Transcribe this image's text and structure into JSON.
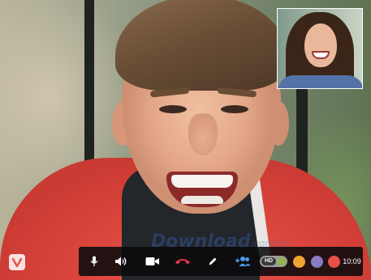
{
  "toolbar": {
    "icons": {
      "mic": "microphone-icon",
      "speaker": "speaker-icon",
      "video": "video-camera-icon",
      "hangup": "phone-hangup-icon",
      "draw": "pen-icon",
      "add_user": "add-user-icon"
    },
    "hd_label": "HD",
    "hd_enabled": true,
    "color_swatches": [
      "#f0a532",
      "#8a7bc4",
      "#e8504a"
    ],
    "time": "10:09"
  },
  "watermark": {
    "text": "Download",
    "suffix": ".com.vn"
  },
  "app_logo": {
    "letter": "V"
  },
  "colors": {
    "toolbar_bg": "#0a0a0c",
    "hangup_red": "#e8344a",
    "add_user_blue": "#4a9be8",
    "hd_green": "#8fb84a"
  }
}
